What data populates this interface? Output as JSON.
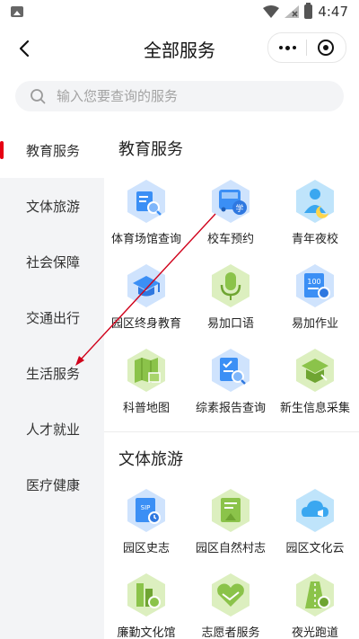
{
  "status_bar": {
    "time": "4:47"
  },
  "header": {
    "title": "全部服务"
  },
  "search": {
    "placeholder": "输入您要查询的服务"
  },
  "sidebar": {
    "items": [
      {
        "label": "教育服务",
        "active": true
      },
      {
        "label": "文体旅游",
        "active": false
      },
      {
        "label": "社会保障",
        "active": false
      },
      {
        "label": "交通出行",
        "active": false
      },
      {
        "label": "生活服务",
        "active": false
      },
      {
        "label": "人才就业",
        "active": false
      },
      {
        "label": "医疗健康",
        "active": false
      }
    ]
  },
  "sections": [
    {
      "title": "教育服务",
      "items": [
        {
          "label": "体育场馆查询",
          "icon": "stadium-search-icon",
          "color": "#3b8ff5"
        },
        {
          "label": "校车预约",
          "icon": "school-bus-icon",
          "color": "#3b8ff5",
          "badge": "学"
        },
        {
          "label": "青年夜校",
          "icon": "night-school-icon",
          "color": "#3aa7f0"
        },
        {
          "label": "园区终身教育",
          "icon": "graduation-cap-icon",
          "color": "#3b8ff5"
        },
        {
          "label": "易加口语",
          "icon": "microphone-icon",
          "color": "#8bc34a"
        },
        {
          "label": "易加作业",
          "icon": "homework-icon",
          "color": "#3b8ff5",
          "badge": "100"
        },
        {
          "label": "科普地图",
          "icon": "map-icon",
          "color": "#8bc34a"
        },
        {
          "label": "综素报告查询",
          "icon": "report-search-icon",
          "color": "#3b8ff5"
        },
        {
          "label": "新生信息采集",
          "icon": "student-info-icon",
          "color": "#8bc34a"
        }
      ]
    },
    {
      "title": "文体旅游",
      "items": [
        {
          "label": "园区史志",
          "icon": "history-book-icon",
          "color": "#3b8ff5",
          "badge": "SIP"
        },
        {
          "label": "园区自然村志",
          "icon": "village-record-icon",
          "color": "#8bc34a"
        },
        {
          "label": "园区文化云",
          "icon": "culture-cloud-icon",
          "color": "#3aa7f0"
        },
        {
          "label": "廉勤文化馆",
          "icon": "building-icon",
          "color": "#8bc34a"
        },
        {
          "label": "志愿者服务",
          "icon": "handshake-icon",
          "color": "#8bc34a"
        },
        {
          "label": "夜光跑道",
          "icon": "running-track-icon",
          "color": "#8bc34a"
        }
      ]
    }
  ],
  "colors": {
    "accent": "#e60012",
    "blue": "#3b8ff5",
    "green": "#8bc34a",
    "arrow": "#d0021b"
  }
}
